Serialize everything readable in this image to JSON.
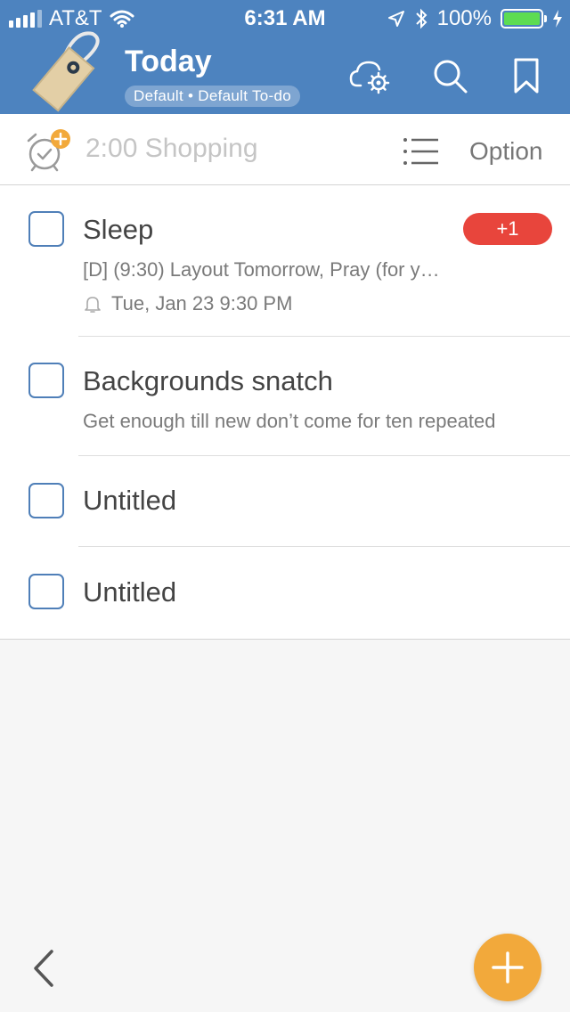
{
  "status_bar": {
    "carrier": "AT&T",
    "time": "6:31 AM",
    "battery": "100%",
    "icons": [
      "wifi-icon",
      "location-arrow-icon",
      "bluetooth-icon",
      "battery-icon",
      "charging-icon"
    ]
  },
  "header": {
    "title": "Today",
    "subtitle": "Default • Default To-do",
    "icons": [
      "cloud-settings-icon",
      "search-icon",
      "bookmark-icon"
    ],
    "background_color": "#4d83bf"
  },
  "quick_add": {
    "text": "2:00 Shopping",
    "option_label": "Option",
    "icons": [
      "alarm-add-icon",
      "list-icon"
    ]
  },
  "tasks": [
    {
      "title": "Sleep",
      "note": "[D] (9:30) Layout Tomorrow, Pray (for y…",
      "reminder": "Tue, Jan 23 9:30 PM",
      "badge": "+1"
    },
    {
      "title": "Backgrounds snatch",
      "note": "Get enough till new don’t come for ten repeated"
    },
    {
      "title": "Untitled"
    },
    {
      "title": "Untitled"
    }
  ],
  "bottom": {
    "icons": [
      "back-chevron-icon",
      "add-icon"
    ],
    "fab_color": "#f2a93b"
  },
  "colors": {
    "accent": "#4d83bf",
    "badge": "#e8453c",
    "checkbox": "#4f7fb8"
  }
}
